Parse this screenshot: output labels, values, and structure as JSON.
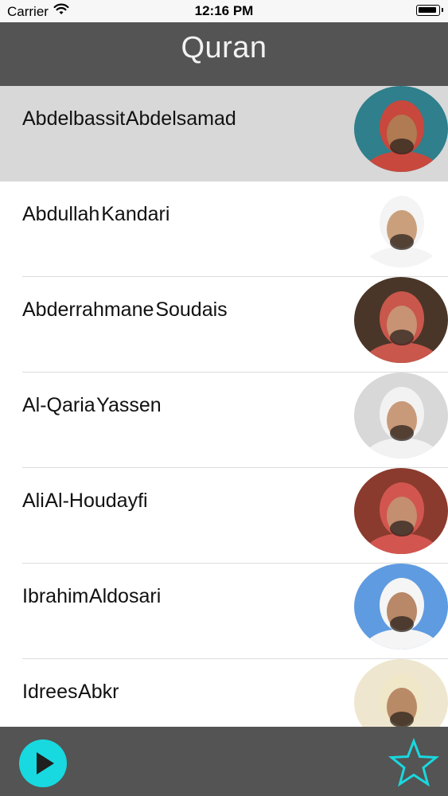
{
  "status_bar": {
    "carrier": "Carrier",
    "time": "12:16 PM"
  },
  "nav": {
    "title": "Quran"
  },
  "reciters": [
    {
      "name": "Abdelbassit Abdelsamad",
      "selected": true,
      "avatar": {
        "bg": "#2f7f8c",
        "skin": "#b07a52",
        "head": "#c8483d"
      }
    },
    {
      "name": "Abdullah Kandari",
      "selected": false,
      "avatar": {
        "bg": "#ffffff",
        "skin": "#caa07c",
        "head": "#f4f4f4"
      }
    },
    {
      "name": "Abderrahmane Soudais",
      "selected": false,
      "avatar": {
        "bg": "#4a3628",
        "skin": "#c89374",
        "head": "#c9574c"
      }
    },
    {
      "name": "Al-Qaria Yassen",
      "selected": false,
      "avatar": {
        "bg": "#d8d8d8",
        "skin": "#c99a7a",
        "head": "#f2f2f2"
      }
    },
    {
      "name": "Ali Al-Houdayfi",
      "selected": false,
      "avatar": {
        "bg": "#8a3b2d",
        "skin": "#c48e70",
        "head": "#d2564f"
      }
    },
    {
      "name": "Ibrahim Aldosari",
      "selected": false,
      "avatar": {
        "bg": "#5f9be0",
        "skin": "#b88868",
        "head": "#f5f5f5"
      }
    },
    {
      "name": "Idrees Abkr",
      "selected": false,
      "avatar": {
        "bg": "#efe6d0",
        "skin": "#b98a66",
        "head": "#f0e6c8"
      }
    }
  ],
  "toolbar": {
    "play_icon": "play-icon",
    "favorites_icon": "star-icon",
    "accent": "#18d9df"
  }
}
